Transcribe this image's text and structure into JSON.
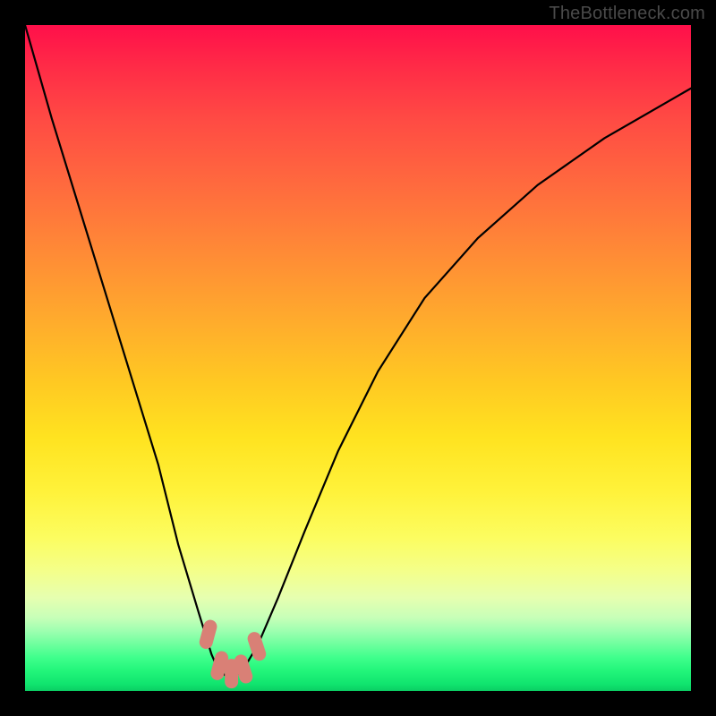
{
  "watermark": "TheBottleneck.com",
  "chart_data": {
    "type": "line",
    "title": "",
    "xlabel": "",
    "ylabel": "",
    "ylim": [
      0,
      100
    ],
    "xlim": [
      0,
      100
    ],
    "series": [
      {
        "name": "bottleneck-curve",
        "x": [
          0,
          4,
          8,
          12,
          16,
          20,
          23,
          26,
          28,
          29,
          30,
          31,
          32,
          33,
          35,
          38,
          42,
          47,
          53,
          60,
          68,
          77,
          87,
          100
        ],
        "values": [
          100,
          86,
          73,
          60,
          47,
          34,
          22,
          12,
          5.5,
          3.2,
          2.4,
          2.2,
          2.6,
          3.6,
          7.0,
          14,
          24,
          36,
          48,
          59,
          68,
          76,
          83,
          90.5
        ]
      }
    ],
    "markers": [
      {
        "name": "marker-left-knee",
        "x": 27.5,
        "y": 8.5
      },
      {
        "name": "marker-bottom-a",
        "x": 29.2,
        "y": 3.8
      },
      {
        "name": "marker-bottom-b",
        "x": 31.0,
        "y": 2.6
      },
      {
        "name": "marker-bottom-c",
        "x": 32.8,
        "y": 3.3
      },
      {
        "name": "marker-right-knee",
        "x": 34.8,
        "y": 6.7
      }
    ],
    "colors": {
      "curve": "#000000",
      "marker": "#d98076",
      "gradient_top": "#ff0f4a",
      "gradient_bottom": "#0bce64",
      "watermark": "#4a4a4a",
      "frame": "#000000"
    }
  }
}
